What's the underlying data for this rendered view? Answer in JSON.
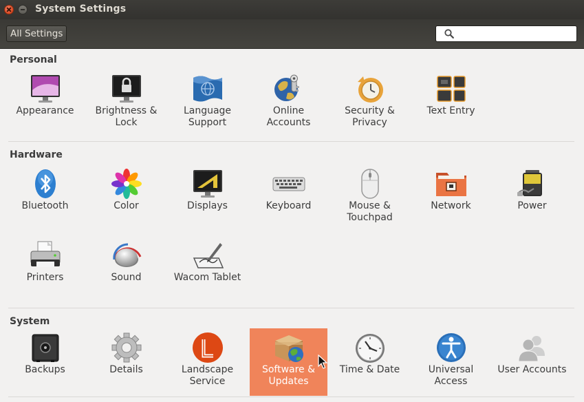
{
  "window": {
    "title": "System Settings",
    "all_settings_label": "All Settings",
    "search": {
      "value": "",
      "placeholder": ""
    }
  },
  "sections": {
    "personal": {
      "title": "Personal",
      "items": [
        {
          "label": "Appearance",
          "icon": "appearance-icon"
        },
        {
          "label": "Brightness & Lock",
          "icon": "brightness-lock-icon"
        },
        {
          "label": "Language Support",
          "icon": "language-support-icon"
        },
        {
          "label": "Online Accounts",
          "icon": "online-accounts-icon"
        },
        {
          "label": "Security & Privacy",
          "icon": "security-privacy-icon"
        },
        {
          "label": "Text Entry",
          "icon": "text-entry-icon"
        }
      ]
    },
    "hardware": {
      "title": "Hardware",
      "items": [
        {
          "label": "Bluetooth",
          "icon": "bluetooth-icon"
        },
        {
          "label": "Color",
          "icon": "color-icon"
        },
        {
          "label": "Displays",
          "icon": "displays-icon"
        },
        {
          "label": "Keyboard",
          "icon": "keyboard-icon"
        },
        {
          "label": "Mouse & Touchpad",
          "icon": "mouse-touchpad-icon"
        },
        {
          "label": "Network",
          "icon": "network-icon"
        },
        {
          "label": "Power",
          "icon": "power-icon"
        },
        {
          "label": "Printers",
          "icon": "printers-icon"
        },
        {
          "label": "Sound",
          "icon": "sound-icon"
        },
        {
          "label": "Wacom Tablet",
          "icon": "wacom-tablet-icon"
        }
      ]
    },
    "system": {
      "title": "System",
      "items": [
        {
          "label": "Backups",
          "icon": "backups-icon"
        },
        {
          "label": "Details",
          "icon": "details-icon"
        },
        {
          "label": "Landscape Service",
          "icon": "landscape-service-icon"
        },
        {
          "label": "Software & Updates",
          "icon": "software-updates-icon",
          "selected": true
        },
        {
          "label": "Time & Date",
          "icon": "time-date-icon"
        },
        {
          "label": "Universal Access",
          "icon": "universal-access-icon"
        },
        {
          "label": "User Accounts",
          "icon": "user-accounts-icon"
        }
      ]
    }
  },
  "colors": {
    "selection": "#f0845a",
    "titlebar": "#3c3b37",
    "background": "#f2f1f0"
  }
}
